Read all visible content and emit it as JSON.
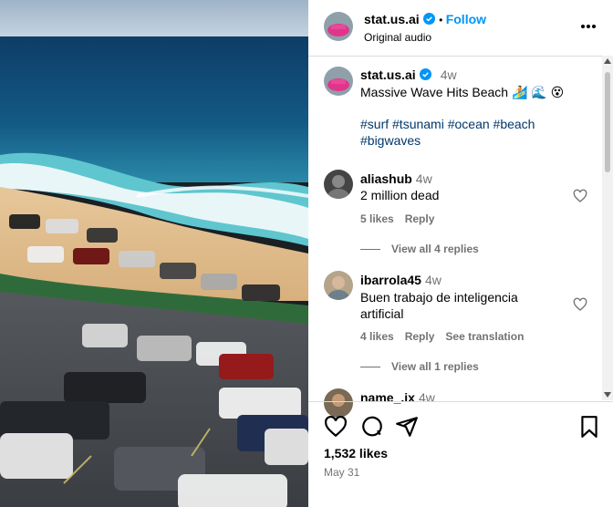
{
  "post": {
    "username": "stat.us.ai",
    "follow_label": "Follow",
    "audio": "Original audio",
    "caption_time": "4w",
    "caption": "Massive Wave Hits Beach 🏄 🌊 😵",
    "hashtags_line1": "#surf #tsunami #ocean #beach",
    "hashtags_line2": "#bigwaves",
    "likes": "1,532 likes",
    "date": "May 31"
  },
  "comments": [
    {
      "username": "aliashub",
      "time": "4w",
      "text": "2 million dead",
      "likes": "5 likes",
      "reply": "Reply",
      "view_replies": "View all 4 replies"
    },
    {
      "username": "ibarrola45",
      "time": "4w",
      "text": "Buen trabajo de inteligencia artificial",
      "likes": "4 likes",
      "reply": "Reply",
      "translate": "See translation",
      "view_replies": "View all 1 replies"
    },
    {
      "username": "name_.ix",
      "time": "4w"
    }
  ],
  "icons": {
    "more": "more-options-icon",
    "like": "heart-icon",
    "comment": "comment-icon",
    "share": "share-icon",
    "save": "bookmark-icon"
  },
  "colors": {
    "link_blue": "#0095f6",
    "hashtag_blue": "#00376b",
    "muted": "#737373",
    "verified_blue": "#0095f6"
  }
}
